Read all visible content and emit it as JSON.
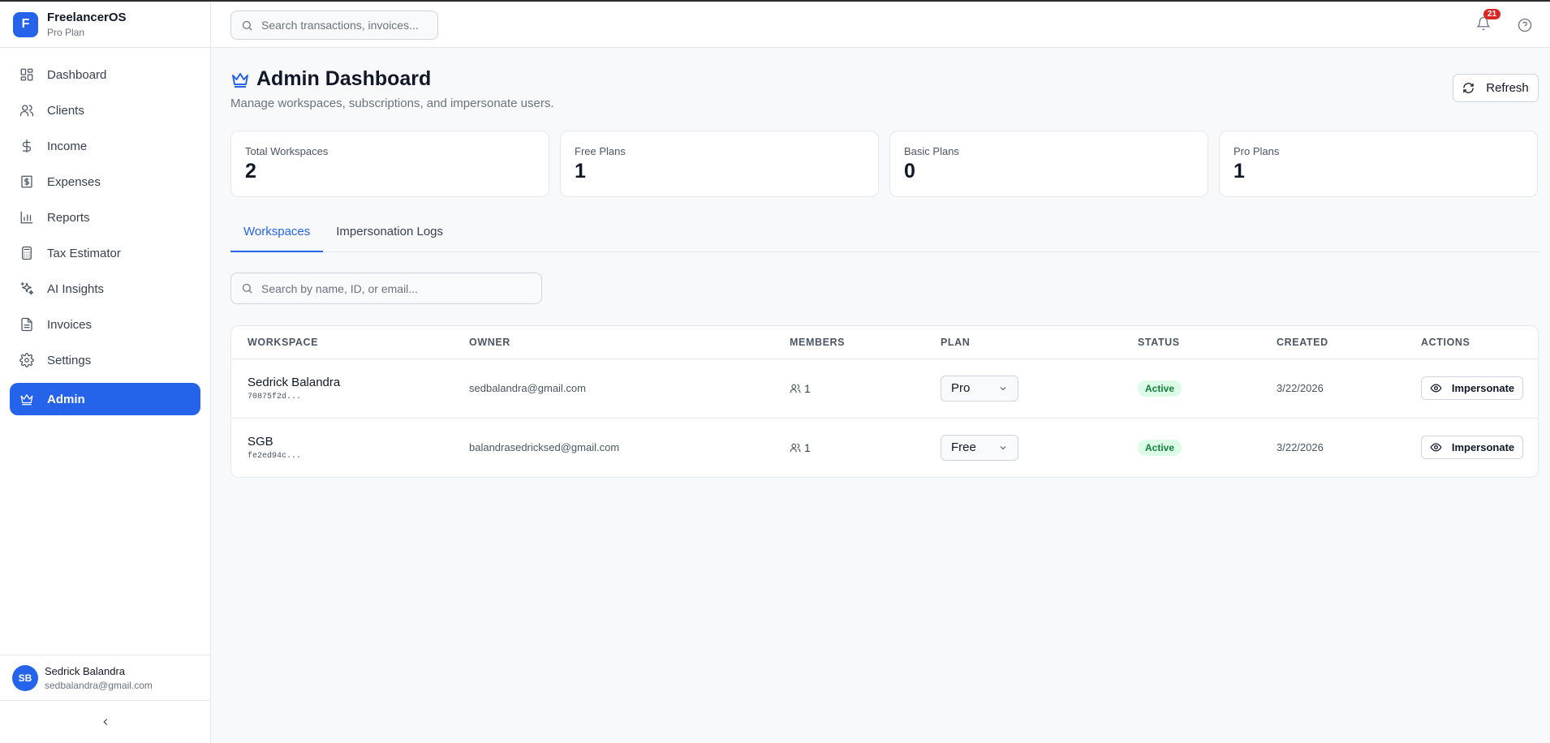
{
  "app": {
    "name": "FreelancerOS",
    "plan": "Pro Plan",
    "logo_letter": "F"
  },
  "sidebar": {
    "items": [
      {
        "label": "Dashboard",
        "icon": "grid-icon"
      },
      {
        "label": "Clients",
        "icon": "users-icon"
      },
      {
        "label": "Income",
        "icon": "dollar-icon"
      },
      {
        "label": "Expenses",
        "icon": "receipt-icon"
      },
      {
        "label": "Reports",
        "icon": "bar-chart-icon"
      },
      {
        "label": "Tax Estimator",
        "icon": "calculator-icon"
      },
      {
        "label": "AI Insights",
        "icon": "sparkles-icon"
      },
      {
        "label": "Invoices",
        "icon": "file-icon"
      },
      {
        "label": "Settings",
        "icon": "gear-icon"
      },
      {
        "label": "Admin",
        "icon": "crown-icon",
        "active": true
      }
    ]
  },
  "user": {
    "initials": "SB",
    "name": "Sedrick Balandra",
    "email": "sedbalandra@gmail.com"
  },
  "topbar": {
    "search_placeholder": "Search transactions, invoices...",
    "notifications": "21"
  },
  "page": {
    "title": "Admin Dashboard",
    "subtitle": "Manage workspaces, subscriptions, and impersonate users.",
    "refresh_label": "Refresh"
  },
  "stats": [
    {
      "label": "Total Workspaces",
      "value": "2"
    },
    {
      "label": "Free Plans",
      "value": "1"
    },
    {
      "label": "Basic Plans",
      "value": "0"
    },
    {
      "label": "Pro Plans",
      "value": "1"
    }
  ],
  "tabs": [
    {
      "label": "Workspaces",
      "active": true
    },
    {
      "label": "Impersonation Logs"
    }
  ],
  "table": {
    "search_placeholder": "Search by name, ID, or email...",
    "columns": [
      "WORKSPACE",
      "OWNER",
      "MEMBERS",
      "PLAN",
      "STATUS",
      "CREATED",
      "ACTIONS"
    ],
    "rows": [
      {
        "name": "Sedrick Balandra",
        "id": "70875f2d...",
        "owner": "sedbalandra@gmail.com",
        "members": "1",
        "plan": "Pro",
        "status": "Active",
        "created": "3/22/2026",
        "action": "Impersonate"
      },
      {
        "name": "SGB",
        "id": "fe2ed94c...",
        "owner": "balandrasedricksed@gmail.com",
        "members": "1",
        "plan": "Free",
        "status": "Active",
        "created": "3/22/2026",
        "action": "Impersonate"
      }
    ]
  },
  "colors": {
    "accent": "#2563eb",
    "active_badge_bg": "#dcfce7",
    "active_badge_text": "#15803d",
    "notification": "#dc2626"
  }
}
